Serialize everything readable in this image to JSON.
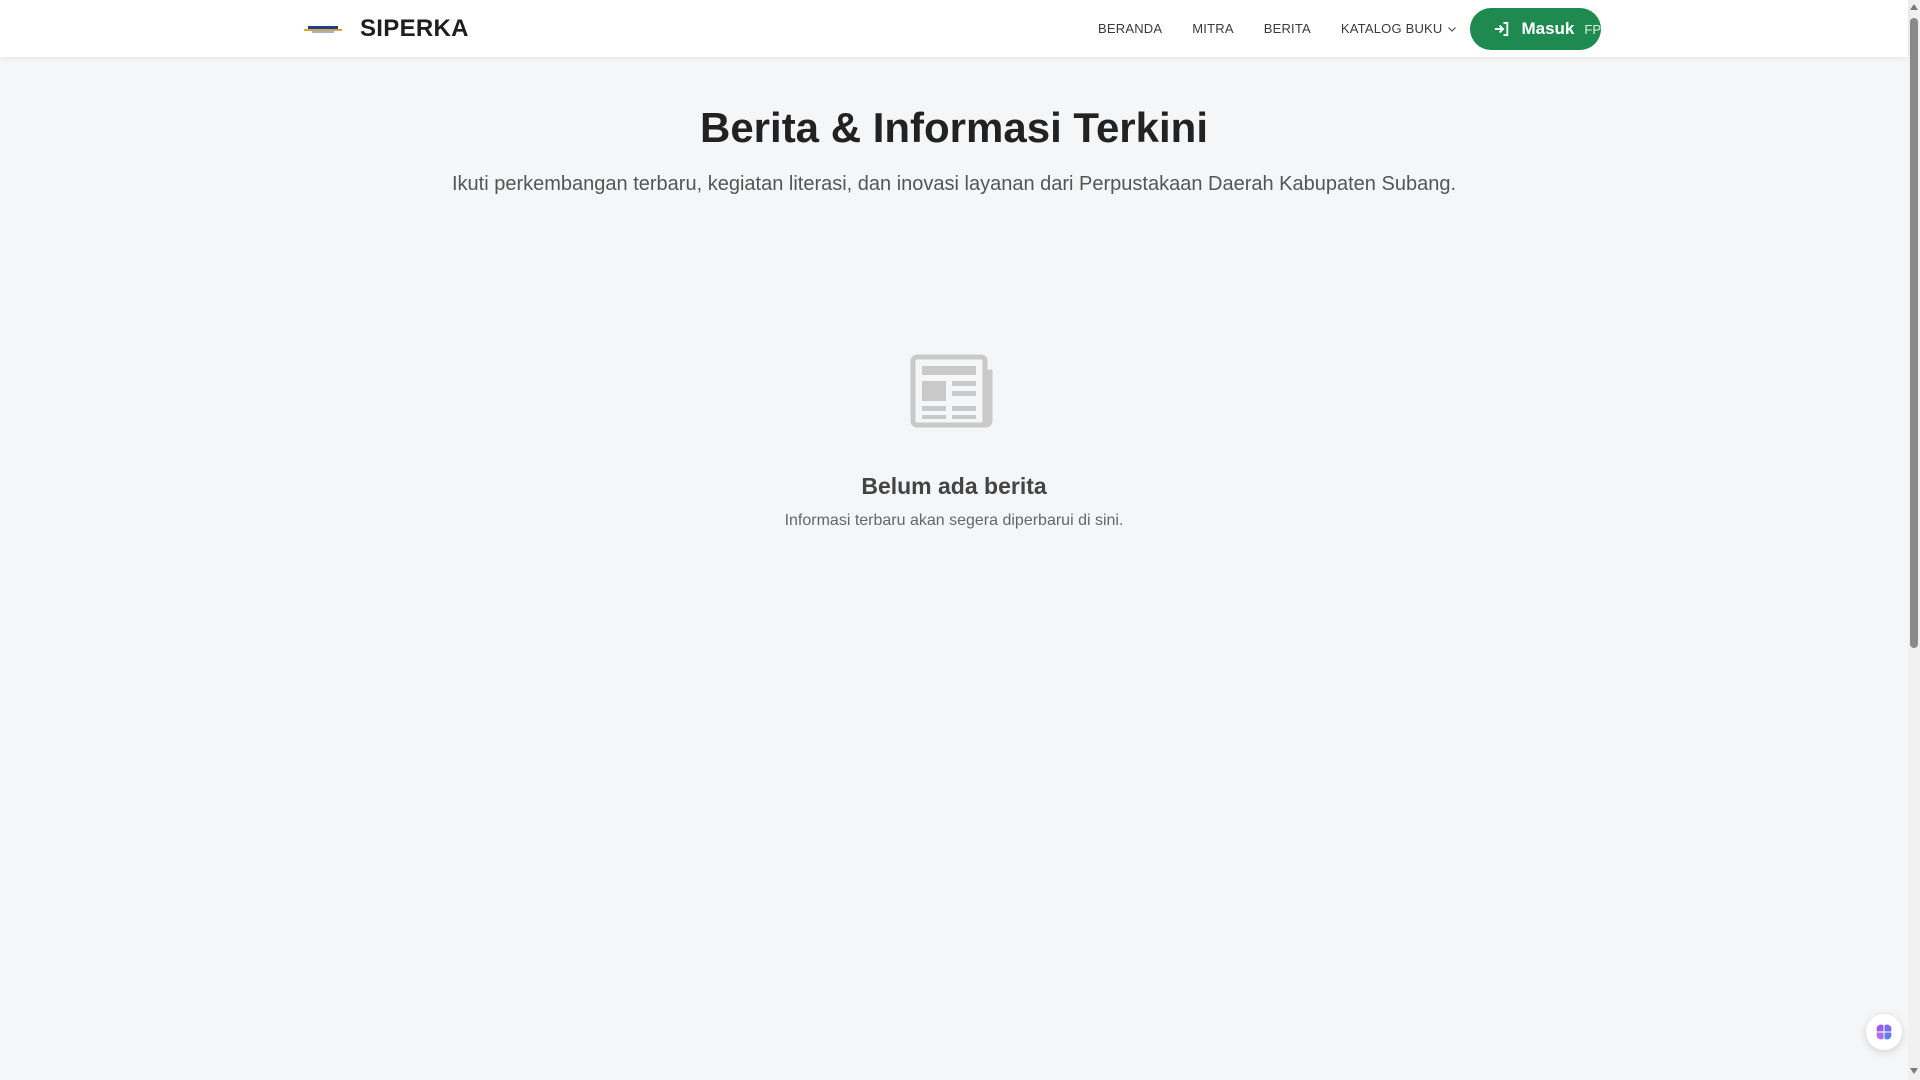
{
  "brand": {
    "name": "SIPERKA",
    "logo_icon": "library-logo-icon"
  },
  "nav": {
    "items": [
      {
        "label": "BERANDA"
      },
      {
        "label": "MITRA"
      },
      {
        "label": "BERITA"
      },
      {
        "label": "KATALOG BUKU",
        "icon": "chevron-down-icon"
      }
    ],
    "login": {
      "label": "Masuk",
      "extra": "FP",
      "icon": "login-icon",
      "color": "#1e8a4f"
    }
  },
  "hero": {
    "title": "Berita & Informasi Terkini",
    "subtitle": "Ikuti perkembangan terbaru, kegiatan literasi, dan inovasi layanan dari Perpustakaan Daerah Kabupaten Subang."
  },
  "empty_state": {
    "icon": "newspaper-icon",
    "title": "Belum ada berita",
    "text": "Informasi terbaru akan segera diperbarui di sini."
  },
  "widget": {
    "icon": "brain-icon"
  }
}
